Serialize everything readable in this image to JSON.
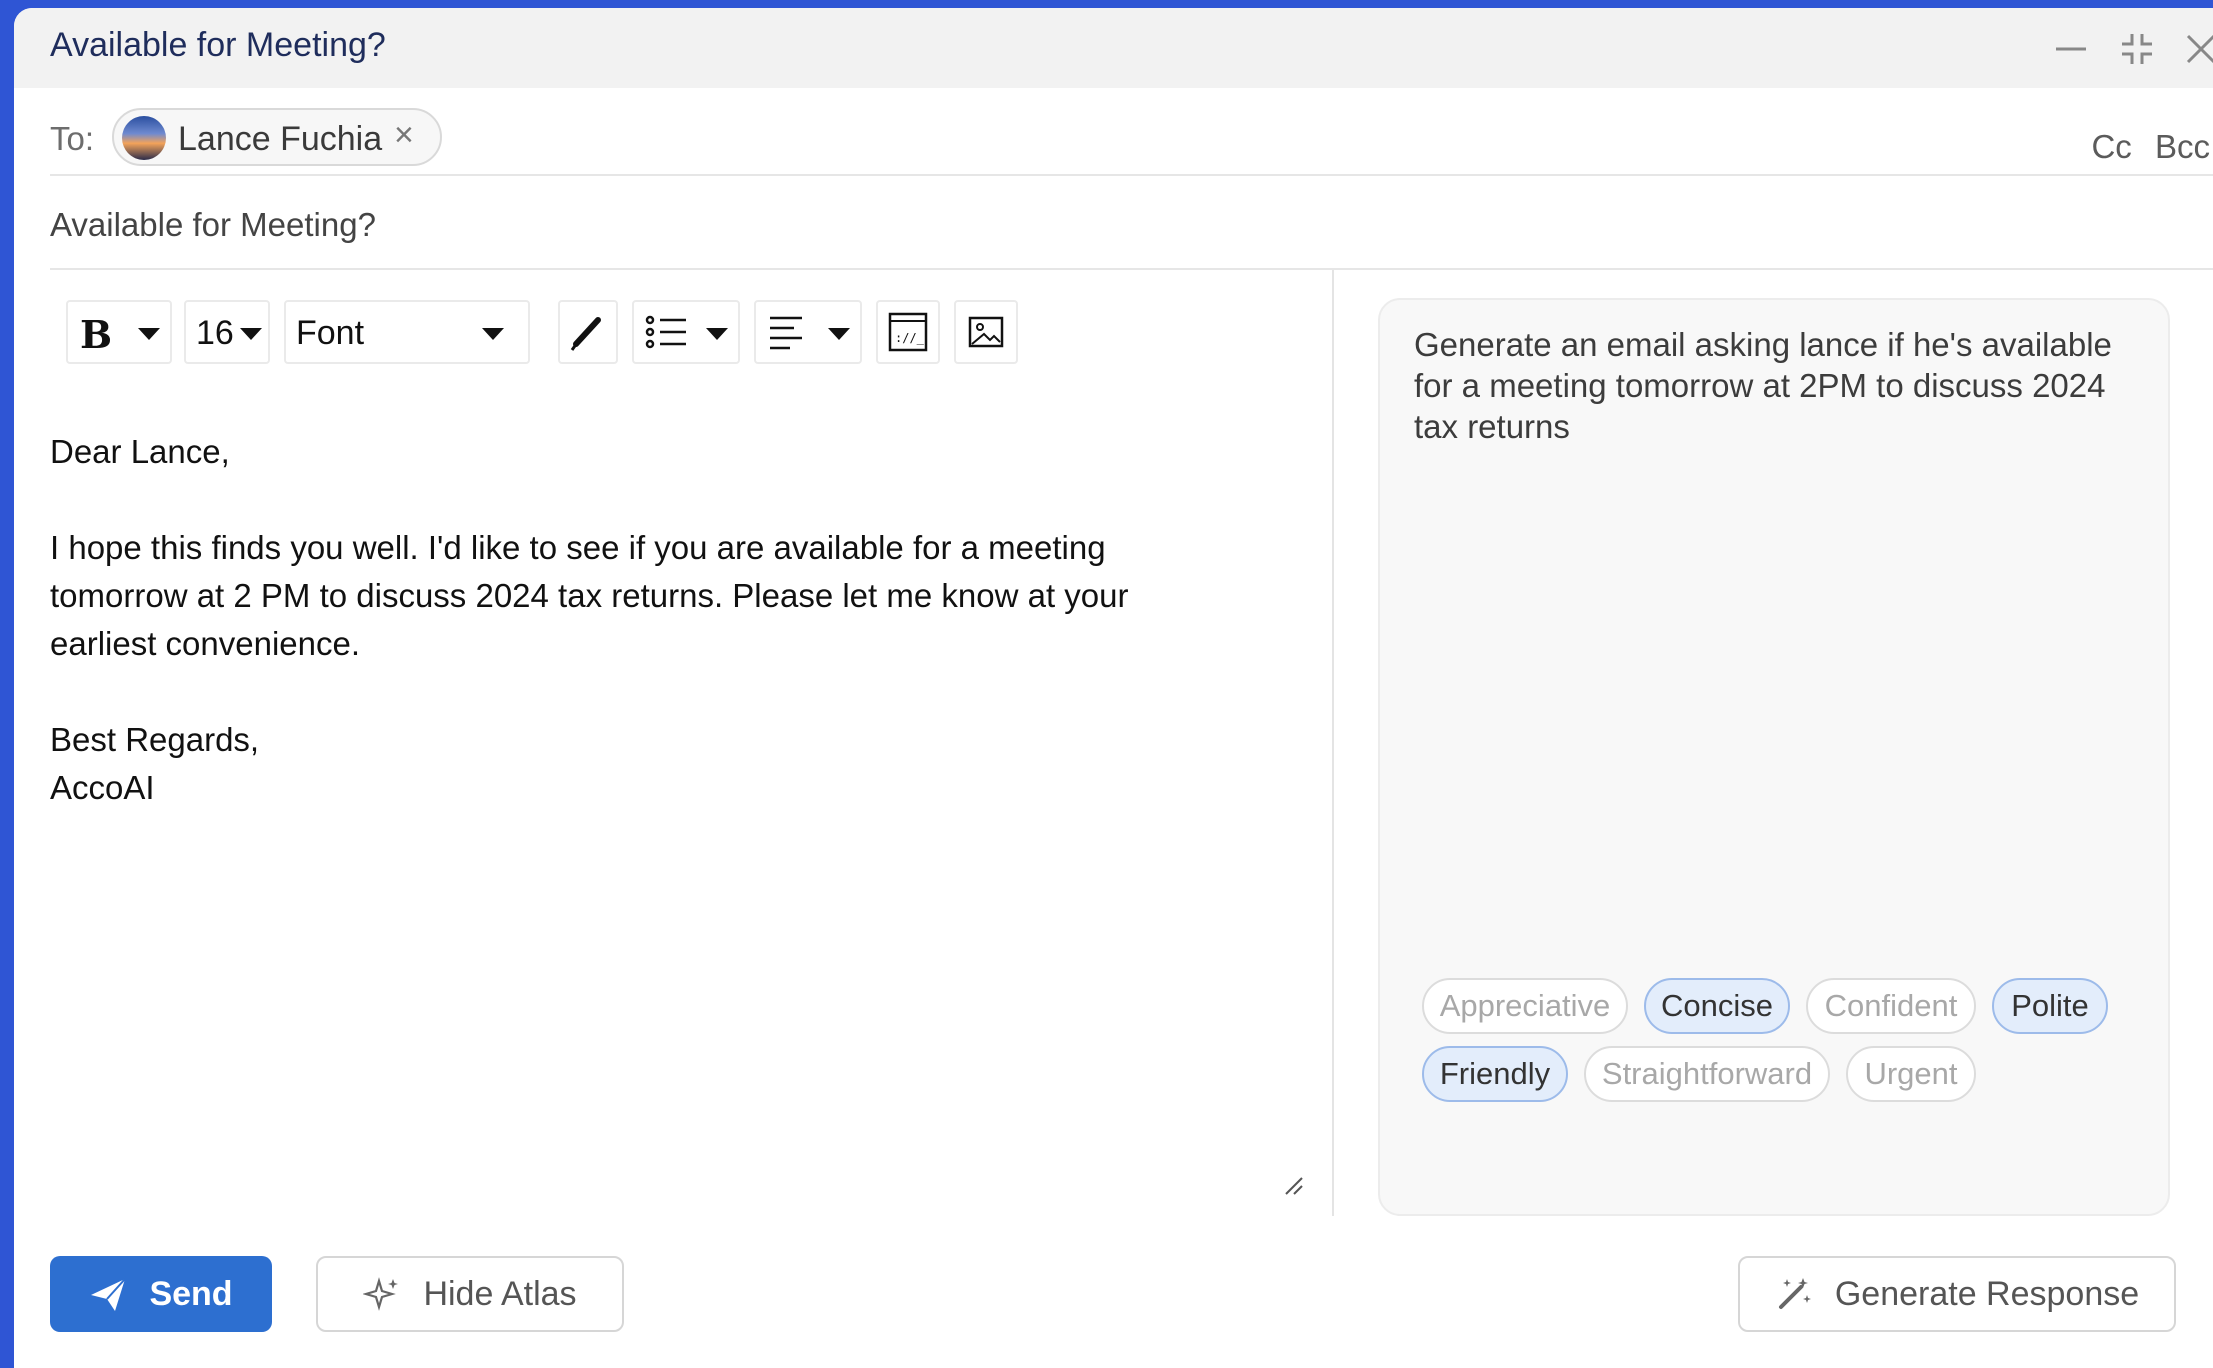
{
  "window": {
    "title": "Available for Meeting?",
    "controls": [
      "minimize-icon",
      "collapse-icon",
      "close-icon"
    ]
  },
  "recipients": {
    "to_label": "To:",
    "to": [
      {
        "name": "Lance Fuchia",
        "remove": "×"
      }
    ],
    "cc_label": "Cc",
    "bcc_label": "Bcc"
  },
  "subject": "Available for Meeting?",
  "toolbar": {
    "bold_label": "B",
    "font_size": "16",
    "font_label": "Font",
    "icons": [
      "pen-icon",
      "bullet-list-icon",
      "align-left-icon",
      "html-code-icon",
      "image-icon"
    ]
  },
  "body": {
    "greeting": "Dear Lance,",
    "paragraph_line1": "I hope this finds you well. I'd like to see if you are available for a meeting",
    "paragraph_line2": "tomorrow at 2 PM to discuss 2024 tax returns. Please let me know at your",
    "paragraph_line3": "earliest convenience.",
    "closing": "Best Regards,",
    "signature": "AccoAI"
  },
  "atlas": {
    "prompt": "Generate an email asking lance if he's available for a meeting tomorrow at 2PM to discuss 2024 tax returns",
    "tones": [
      {
        "label": "Appreciative",
        "selected": false
      },
      {
        "label": "Concise",
        "selected": true
      },
      {
        "label": "Confident",
        "selected": false
      },
      {
        "label": "Polite",
        "selected": true
      },
      {
        "label": "Friendly",
        "selected": true
      },
      {
        "label": "Straightforward",
        "selected": false
      },
      {
        "label": "Urgent",
        "selected": false
      }
    ]
  },
  "footer": {
    "send_label": "Send",
    "hide_atlas_label": "Hide Atlas",
    "generate_label": "Generate Response"
  },
  "colors": {
    "background": "#2f55d4",
    "primary": "#2d6fd0",
    "selected_tone": "#e3edfb"
  }
}
